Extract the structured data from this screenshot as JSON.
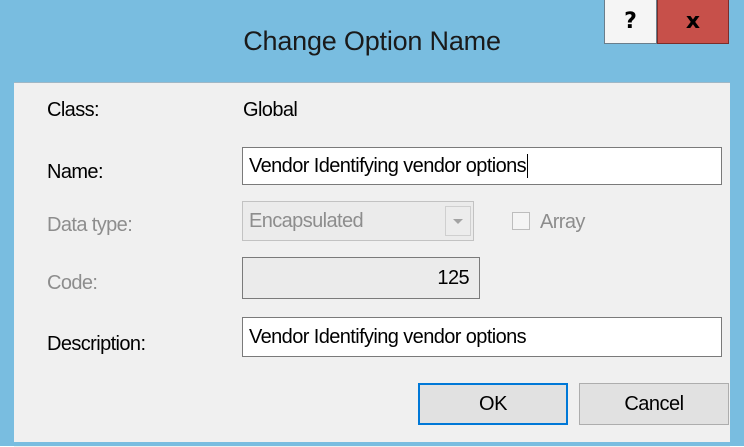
{
  "window": {
    "title": "Change Option Name",
    "help_glyph": "?",
    "close_glyph": "x",
    "colors": {
      "frame": "#79bde0",
      "close_button": "#c7504a",
      "client_background": "#f0f0f0",
      "default_button_border": "#0078d7"
    }
  },
  "form": {
    "class_label": "Class:",
    "class_value": "Global",
    "name_label": "Name:",
    "name_value": "Vendor Identifying vendor options",
    "data_type_label": "Data type:",
    "data_type_value": "Encapsulated",
    "array_label": "Array",
    "array_checked": false,
    "code_label": "Code:",
    "code_value": "125",
    "description_label": "Description:",
    "description_value": "Vendor Identifying vendor options"
  },
  "buttons": {
    "ok_label": "OK",
    "cancel_label": "Cancel"
  },
  "icons": {
    "help": "help-icon",
    "close": "close-icon",
    "dropdown": "chevron-down-icon",
    "checkbox": "checkbox-icon"
  }
}
